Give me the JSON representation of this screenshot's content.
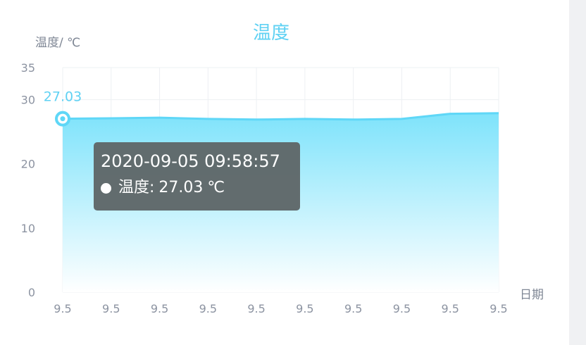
{
  "chart_data": {
    "type": "area",
    "title": "温度",
    "ylabel": "温度/ ℃",
    "xlabel": "日期",
    "ylim": [
      0,
      35
    ],
    "yticks": [
      0,
      10,
      20,
      30,
      35
    ],
    "x": [
      "9.5",
      "9.5",
      "9.5",
      "9.5",
      "9.5",
      "9.5",
      "9.5",
      "9.5",
      "9.5",
      "9.5"
    ],
    "series": [
      {
        "values": [
          27.03,
          27.1,
          27.2,
          27.0,
          26.9,
          27.0,
          26.9,
          27.0,
          27.8,
          27.9
        ]
      }
    ],
    "highlighted_point": {
      "index": 0,
      "label": "27.03"
    },
    "grid": true,
    "colors": {
      "line": "#5fd7f7",
      "area_top": "#7ee3fb",
      "area_bottom": "#ffffff",
      "title": "#5fd1f3"
    }
  },
  "tooltip": {
    "time": "2020-09-05 09:58:57",
    "series_name": "温度:",
    "value": "27.03",
    "unit": "℃"
  }
}
